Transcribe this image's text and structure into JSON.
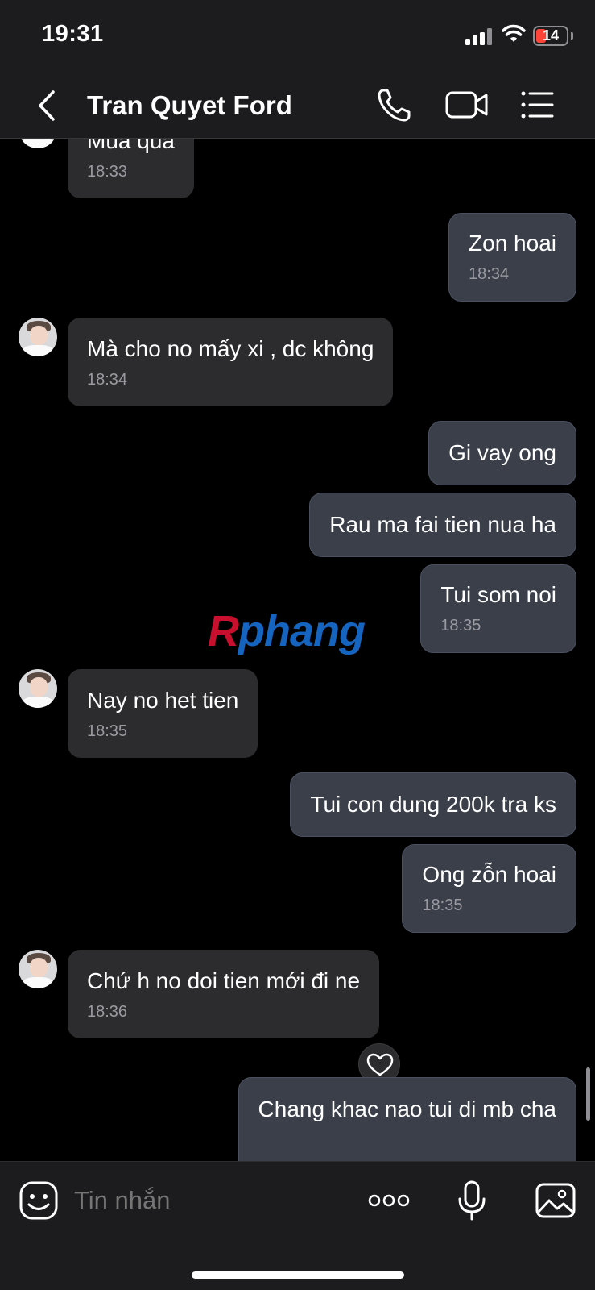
{
  "status_bar": {
    "time": "19:31",
    "battery": "14",
    "battery_color": "#ff453a"
  },
  "header": {
    "title": "Tran Quyet Ford",
    "icons": [
      "back-arrow-icon",
      "phone-icon",
      "video-camera-icon",
      "list-menu-icon"
    ]
  },
  "messages": [
    {
      "side": "in",
      "text": "Mua qua",
      "time": "18:33"
    },
    {
      "side": "out",
      "text": "Zon hoai",
      "time": "18:34"
    },
    {
      "side": "in",
      "text": "Mà cho no mấy xi , dc không",
      "time": "18:34"
    },
    {
      "side": "out",
      "text": "Gi vay ong",
      "time": ""
    },
    {
      "side": "out",
      "text": "Rau ma fai tien nua ha",
      "time": ""
    },
    {
      "side": "out",
      "text": "Tui som noi",
      "time": "18:35"
    },
    {
      "side": "in",
      "text": "Nay no het tien",
      "time": "18:35"
    },
    {
      "side": "out",
      "text": "Tui con dung 200k tra ks",
      "time": ""
    },
    {
      "side": "out",
      "text": "Ong zỗn hoai",
      "time": "18:35"
    },
    {
      "side": "in",
      "text": "Chứ h no doi tien mới đi ne",
      "time": "18:36"
    },
    {
      "side": "out",
      "text": "Chang khac nao tui di mb cha",
      "time": ""
    }
  ],
  "watermark": {
    "part1": "R",
    "part2": "phang"
  },
  "input": {
    "placeholder": "Tin nhắn"
  },
  "colors": {
    "incoming_bubble": "#2c2c2e",
    "outgoing_bubble": "#3a3f4a",
    "background": "#000000"
  }
}
